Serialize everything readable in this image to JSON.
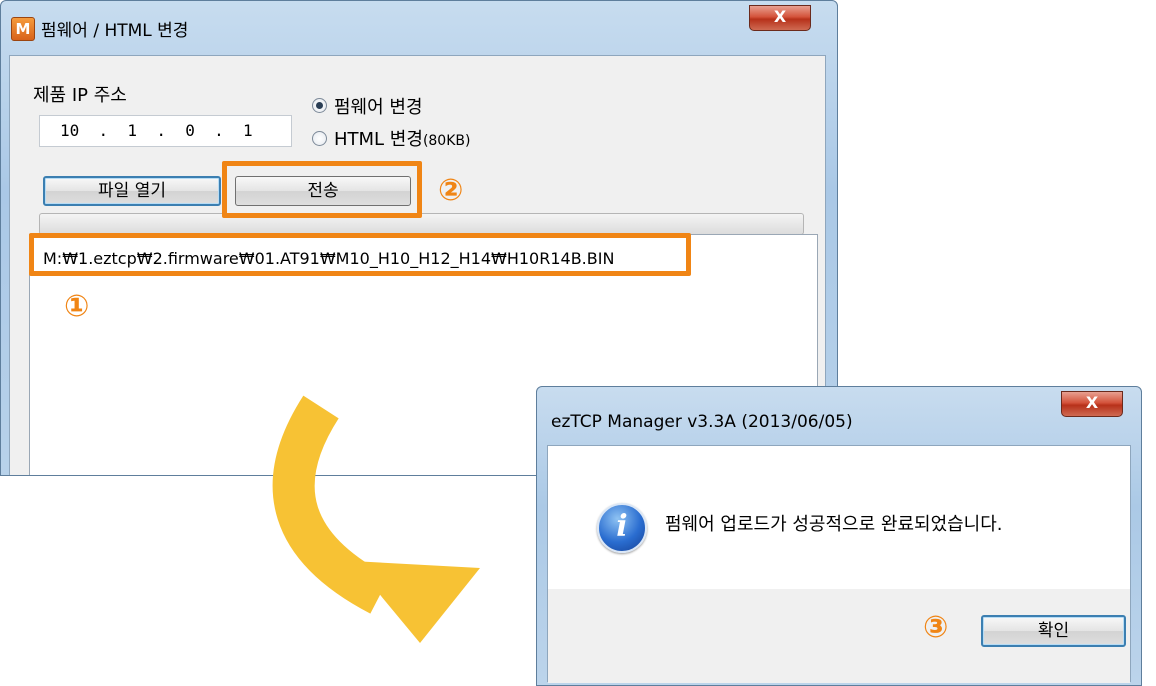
{
  "firmware_window": {
    "title": "펌웨어 / HTML 변경",
    "app_icon": "M",
    "close_label": "X",
    "ip_label": "제품 IP 주소",
    "ip_value": "10  .  1  .  0  .  1",
    "radio_firmware": "펌웨어 변경",
    "radio_html": "HTML 변경",
    "radio_html_size": "(80KB)",
    "selected_option": "펌웨어 변경",
    "open_file_button": "파일 열기",
    "send_button": "전송",
    "file_path": "M:₩1.eztcp₩2.firmware₩01.AT91₩M10_H10_H12_H14₩H10R14B.BIN",
    "progress": 0
  },
  "annotations": {
    "step1": "①",
    "step2": "②",
    "step3": "③",
    "highlight_color": "#f08515",
    "arrow_color": "#f7c234"
  },
  "message_box": {
    "title": "ezTCP Manager v3.3A (2013/06/05)",
    "close_label": "X",
    "icon": "info-icon",
    "message": "펌웨어 업로드가 성공적으로 완료되었습니다.",
    "ok_button": "확인"
  }
}
